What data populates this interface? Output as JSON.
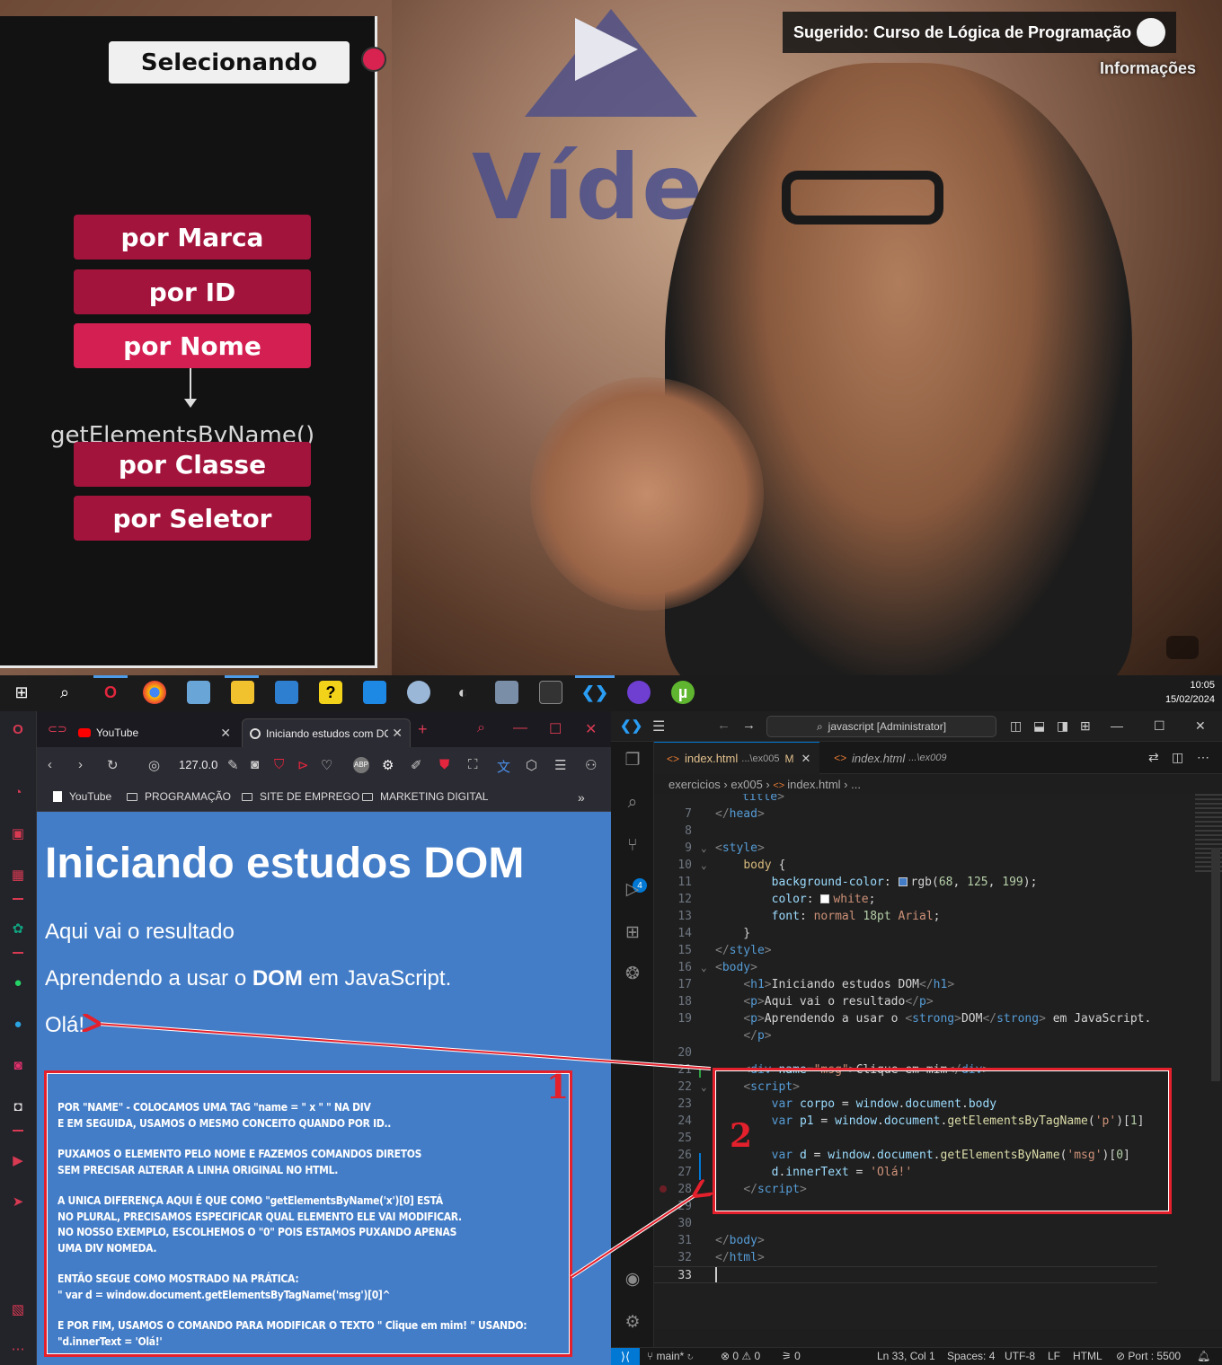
{
  "video": {
    "slide": {
      "title": "Selecionando",
      "buttons": [
        "por Marca",
        "por ID",
        "por Nome",
        "por Classe",
        "por Seletor"
      ],
      "method": "getElementsByName()"
    },
    "suggestion": "Sugerido: Curso de Lógica de Programação",
    "info_label": "Informações",
    "backdrop_word": "Vídeo"
  },
  "taskbar": {
    "icons": [
      "windows-icon",
      "search-icon",
      "opera-icon",
      "chrome-icon",
      "network-icon",
      "explorer-icon",
      "app-icon",
      "help-icon",
      "store-icon",
      "paint-icon",
      "recorder-icon",
      "calculator-icon",
      "terminal-icon",
      "vscode-icon",
      "github-icon",
      "utorrent-icon"
    ],
    "time": "10:05",
    "date": "15/02/2024"
  },
  "browser": {
    "tabs": [
      {
        "label": "YouTube"
      },
      {
        "label": "Iniciando estudos com DOM"
      }
    ],
    "new_tab": "+",
    "url": "127.0.0",
    "bookmarks": [
      "YouTube",
      "PROGRAMAÇÃO",
      "SITE DE EMPREGO",
      "MARKETING DIGITAL"
    ],
    "bookmarks_more": "»",
    "page": {
      "h1": "Iniciando estudos DOM",
      "p1": "Aqui vai o resultado",
      "p2_before": "Aprendendo a usar o ",
      "p2_strong": "DOM",
      "p2_after": " em JavaScript.",
      "div_result": "Olá!"
    },
    "note": {
      "number": "1",
      "paragraphs": [
        "POR \"NAME\" - COLOCAMOS UMA TAG \"name = \" x \" \" NA DIV\nE EM SEGUIDA, USAMOS O MESMO CONCEITO QUANDO POR ID..",
        "PUXAMOS O  ELEMENTO PELO NOME E FAZEMOS COMANDOS DIRETOS\nSEM PRECISAR ALTERAR A LINHA ORIGINAL NO HTML.",
        "A UNICA DIFERENÇA AQUI É QUE COMO \"getElementsByName('x')[0] ESTÁ\nNO PLURAL, PRECISAMOS ESPECIFICAR QUAL ELEMENTO ELE VAI MODIFICAR.\nNO NOSSO EXEMPLO, ESCOLHEMOS O \"0\" POIS ESTAMOS PUXANDO APENAS\nUMA DIV NOMEDA.",
        "ENTÃO SEGUE COMO MOSTRADO NA PRÁTICA:\n\" var d = window.document.getElementsByTagName('msg')[0]^",
        "E POR FIM, USAMOS O COMANDO PARA MODIFICAR O TEXTO \" Clique em mim! \" USANDO:\n\"d.innerText = 'Olá!'"
      ]
    }
  },
  "vscode": {
    "search": "javascript [Administrator]",
    "tabs": [
      {
        "name": "index.html",
        "path": "...\\ex005",
        "status": "M"
      },
      {
        "name": "index.html",
        "path": "...\\ex009"
      }
    ],
    "breadcrumb": [
      "exercicios",
      "ex005",
      "index.html",
      "..."
    ],
    "scm_badge": "4",
    "code_number": "2",
    "status": {
      "branch": "main*",
      "errors": "0",
      "warnings": "0",
      "ports": "0",
      "position": "Ln 33, Col 1",
      "spaces": "Spaces: 4",
      "encoding": "UTF-8",
      "eol": "LF",
      "language": "HTML",
      "port": "Port : 5500"
    }
  }
}
